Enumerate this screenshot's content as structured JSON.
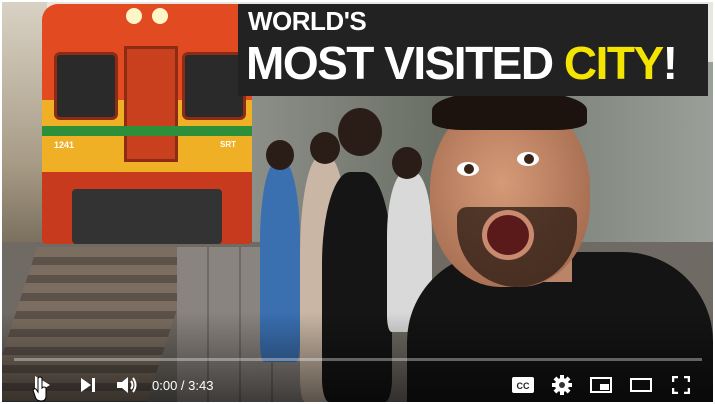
{
  "video": {
    "title_line1": "WORLD'S",
    "title_line2_part1": "MOST VISITED",
    "title_line2_highlight": "CITY",
    "title_line2_part2": "!",
    "train_number": "1241",
    "train_brand": "SRT"
  },
  "player": {
    "time_display": "0:00 / 3:43",
    "progress_fraction": 0.0,
    "icons": {
      "play": "play-icon",
      "next": "next-icon",
      "volume": "volume-icon",
      "captions": "captions-icon",
      "settings": "gear-icon",
      "miniplayer": "miniplayer-icon",
      "theater": "theater-icon",
      "fullscreen": "fullscreen-icon"
    },
    "captions_label": "CC"
  },
  "colors": {
    "highlight": "#f4e500",
    "title_bg": "#222222",
    "control_fg": "#ffffff"
  }
}
